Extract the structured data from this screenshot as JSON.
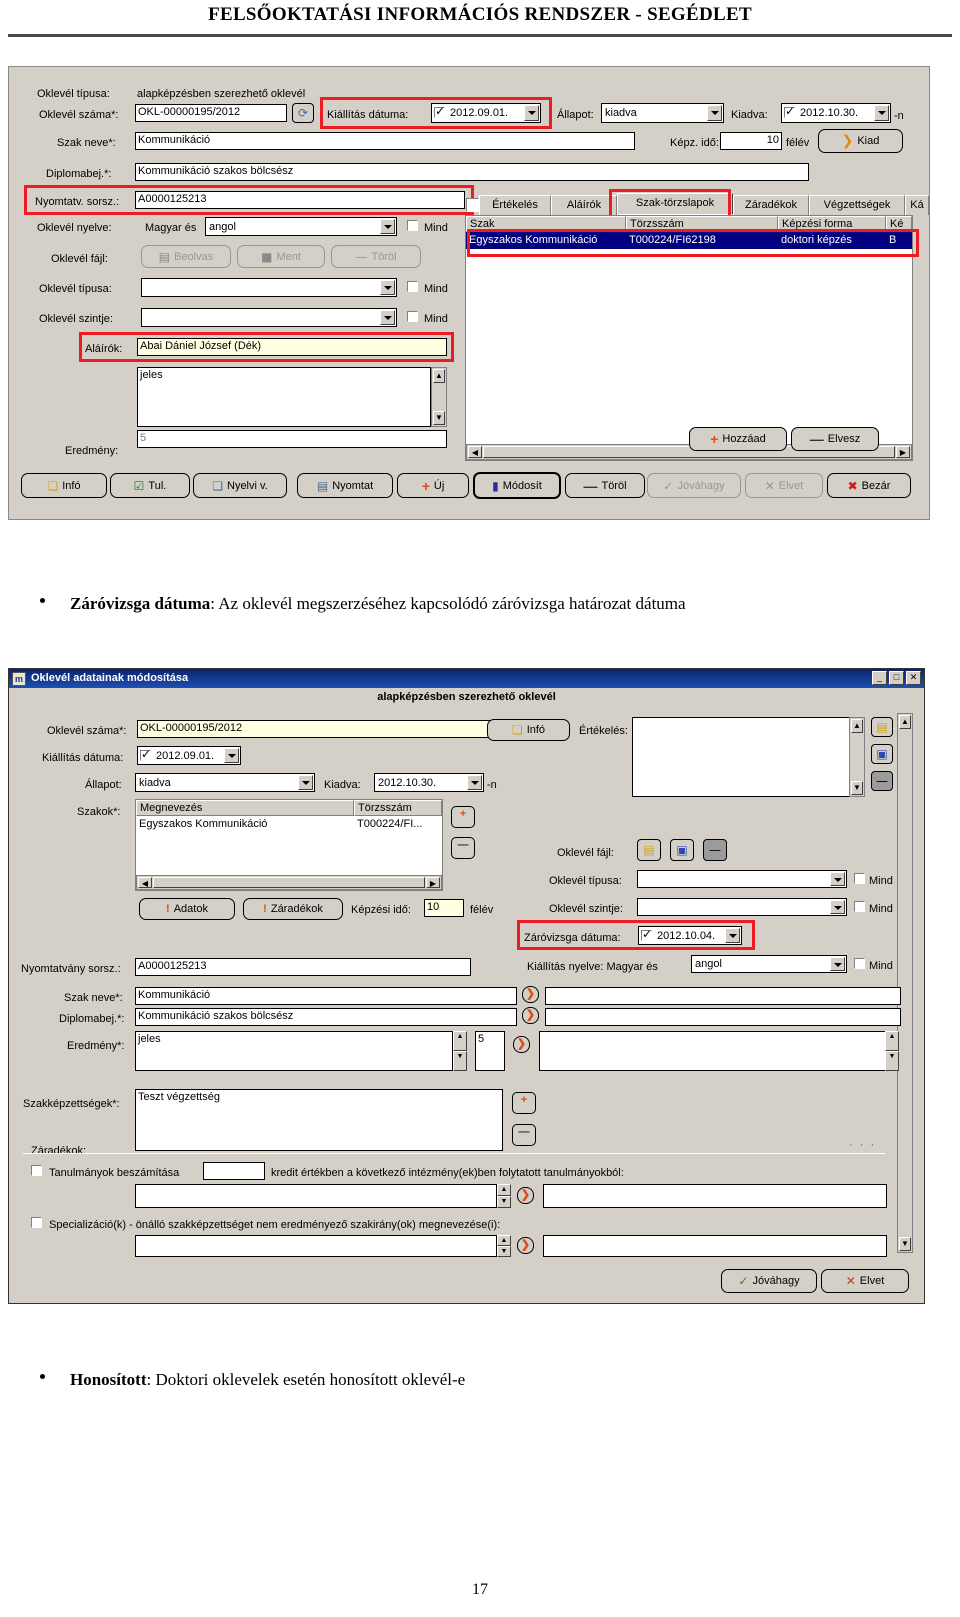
{
  "header": {
    "title": "FELSŐOKTATÁSI INFORMÁCIÓS RENDSZER -  SEGÉDLET"
  },
  "page_number": "17",
  "dialog1": {
    "fields": {
      "oklevel_tipusa_label": "Oklevél típusa:",
      "oklevel_tipusa_value": "alapképzésben szerezhető oklevél",
      "oklevel_szama_label": "Oklevél száma*:",
      "oklevel_szama_value": "OKL-00000195/2012",
      "kiallitas_datuma_label": "Kiállítás dátuma:",
      "kiallitas_datuma_value": "2012.09.01.",
      "allapot_label": "Állapot:",
      "allapot_value": "kiadva",
      "kiadva_label": "Kiadva:",
      "kiadva_value": "2012.10.30.",
      "kiadva_suffix": "-n",
      "szak_neve_label": "Szak neve*:",
      "szak_neve_value": "Kommunikáció",
      "kepz_ido_label": "Képz. idő:",
      "kepz_ido_value": "10",
      "kepz_ido_unit": "félév",
      "kiad_button": "Kiad",
      "diplomabej_label": "Diplomabej.*:",
      "diplomabej_value": "Kommunikáció szakos bölcsész",
      "nyomtatv_label": "Nyomtatv. sorsz.:",
      "nyomtatv_value": "A0000125213",
      "oklevel_nyelve_label": "Oklevél nyelve:",
      "oklevel_nyelve_prefix": "Magyar és",
      "oklevel_nyelve_value": "angol",
      "mind_label": "Mind",
      "oklevel_fajl_label": "Oklevél fájl:",
      "beolvas_button": "Beolvas",
      "ment_button": "Ment",
      "torol_button": "Töröl",
      "oklevel_tipusa2_label": "Oklevél típusa:",
      "oklevel_tipusa2_value": "",
      "oklevel_szintje_label": "Oklevél szintje:",
      "oklevel_szintje_value": "",
      "alairok_label": "Aláírók:",
      "alairok_value": "Abai Dániel József (Dék)",
      "eredmeny_label": "Eredmény:",
      "eredmeny_value": "jeles",
      "eredmeny_num": "5"
    },
    "tabs": [
      {
        "label": "Értékelés",
        "selected": false
      },
      {
        "label": "Aláírók",
        "selected": false
      },
      {
        "label": "Szak-törzslapok",
        "selected": true
      },
      {
        "label": "Záradékok",
        "selected": false
      },
      {
        "label": "Végzettségek",
        "selected": false
      },
      {
        "label": "Ká",
        "selected": false
      }
    ],
    "grid": {
      "columns": [
        "Szak",
        "Törzsszám",
        "Képzési forma",
        "Ké"
      ],
      "rows": [
        [
          "Egyszakos Kommunikáció",
          "T000224/FI62198",
          "doktori képzés",
          "B"
        ]
      ]
    },
    "grid_buttons": {
      "add": "Hozzáad",
      "remove": "Elvesz"
    },
    "toolbar": [
      {
        "label": "Infó",
        "icon": "info-icon",
        "disabled": false
      },
      {
        "label": "Tul.",
        "icon": "properties-icon",
        "disabled": false
      },
      {
        "label": "Nyelvi v.",
        "icon": "language-icon",
        "disabled": false
      },
      {
        "label": "Nyomtat",
        "icon": "print-icon",
        "disabled": false
      },
      {
        "label": "Új",
        "icon": "plus-icon",
        "disabled": false
      },
      {
        "label": "Módosít",
        "icon": "edit-icon",
        "disabled": false
      },
      {
        "label": "Töröl",
        "icon": "minus-icon",
        "disabled": false
      },
      {
        "label": "Jóváhagy",
        "icon": "check-icon",
        "disabled": true
      },
      {
        "label": "Elvet",
        "icon": "x-icon",
        "disabled": true
      },
      {
        "label": "Bezár",
        "icon": "close-icon",
        "disabled": false
      }
    ]
  },
  "bullet1": {
    "term": "Záróvizsga dátuma",
    "rest": ": Az oklevél megszerzéséhez kapcsolódó záróvizsga határozat dátuma"
  },
  "bullet2": {
    "term": "Honosított",
    "rest": ": Doktori oklevelek esetén honosított oklevél-e"
  },
  "dialog2": {
    "title": "Oklevél adatainak módosítása",
    "window_buttons": [
      "_",
      "□",
      "✕"
    ],
    "subtitle": "alapképzésben szerezhető oklevél",
    "fields": {
      "oklevel_szama_label": "Oklevél száma*:",
      "oklevel_szama_value": "OKL-00000195/2012",
      "info_button": "Infó",
      "ertekeles_label": "Értékelés:",
      "kiallitas_datuma_label": "Kiállítás dátuma:",
      "kiallitas_datuma_value": "2012.09.01.",
      "allapot_label": "Állapot:",
      "allapot_value": "kiadva",
      "kiadva_label": "Kiadva:",
      "kiadva_value": "2012.10.30.",
      "kiadva_suffix": "-n",
      "szakok_label": "Szakok*:",
      "adatok_button": "Adatok",
      "zaradekok_button": "Záradékok",
      "kepzesi_ido_label": "Képzési idő:",
      "kepzesi_ido_value": "10",
      "kepzesi_ido_unit": "félév",
      "oklevel_fajl_label": "Oklevél fájl:",
      "oklevel_tipusa_label": "Oklevél típusa:",
      "oklevel_tipusa_value": "",
      "oklevel_szintje_label": "Oklevél szintje:",
      "oklevel_szintje_value": "",
      "zarovizsga_label": "Záróvizsga dátuma:",
      "zarovizsga_value": "2012.10.04.",
      "kiallitas_nyelve_label": "Kiállítás nyelve: Magyar és",
      "kiallitas_nyelve_value": "angol",
      "mind_label": "Mind",
      "nyomtatvany_label": "Nyomtatvány sorsz.:",
      "nyomtatvany_value": "A0000125213",
      "szak_neve_label": "Szak neve*:",
      "szak_neve_value": "Kommunikáció",
      "diplomabej_label": "Diplomabej.*:",
      "diplomabej_value": "Kommunikáció szakos bölcsész",
      "eredmeny_label": "Eredmény*:",
      "eredmeny_value": "jeles",
      "eredmeny_num": "5",
      "szakkepzettsegek_label": "Szakképzettségek*:",
      "szakkepzettsegek_value": "Teszt végzettség",
      "zaradekok_group_label": "Záradékok:",
      "tanulmanyok_check_label": "Tanulmányok beszámítása",
      "tanulmanyok_credit_value": "",
      "tanulmanyok_tail": "kredit értékben a következő intézmény(ek)ben folytatott tanulmányokból:",
      "specializacio_check_label": "Specializáció(k) - önálló szakképzettséget nem eredményező szakirány(ok) megnevezése(i):",
      "jovahagy_button": "Jóváhagy",
      "elvet_button": "Elvet"
    },
    "szakok_grid": {
      "columns": [
        "Megnevezés",
        "Törzsszám"
      ],
      "rows": [
        [
          "Egyszakos Kommunikáció",
          "T000224/FI..."
        ]
      ]
    }
  },
  "colors": {
    "highlight": "#ed1c24",
    "titlebar": "#0a246a",
    "selection": "#000080",
    "face": "#d4d0c8"
  }
}
